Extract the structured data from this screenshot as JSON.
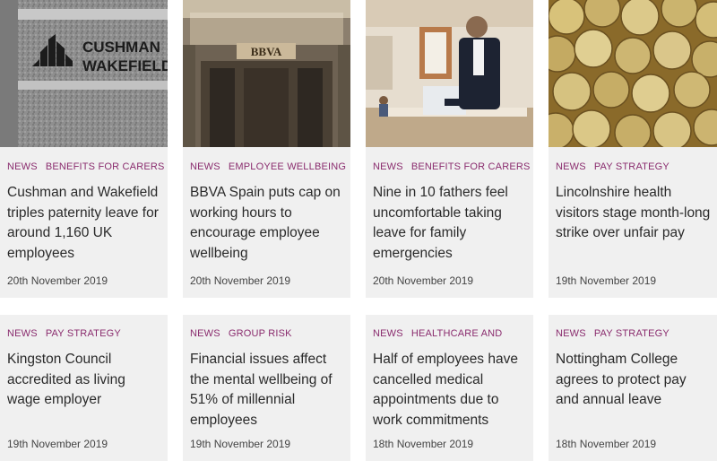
{
  "cards": [
    {
      "tags": [
        "NEWS",
        "BENEFITS FOR CARERS"
      ],
      "headline": "Cushman and Wakefield triples paternity leave for around 1,160 UK employees",
      "date": "20th November 2019",
      "image_logo": {
        "line1": "CUSHMAN",
        "line2": "WAKEFIELD"
      }
    },
    {
      "tags": [
        "NEWS",
        "EMPLOYEE WELLBEING"
      ],
      "headline": "BBVA Spain puts cap on working hours to encourage employee wellbeing",
      "date": "20th November 2019",
      "image_sign": "BBVA"
    },
    {
      "tags": [
        "NEWS",
        "BENEFITS FOR CARERS"
      ],
      "headline": "Nine in 10 fathers feel uncomfortable taking leave for family emergencies",
      "date": "20th November 2019"
    },
    {
      "tags": [
        "NEWS",
        "PAY STRATEGY"
      ],
      "headline": "Lincolnshire health visitors stage month-long strike over unfair pay",
      "date": "19th November 2019"
    },
    {
      "tags": [
        "NEWS",
        "PAY STRATEGY"
      ],
      "headline": "Kingston Council accredited as living wage employer",
      "date": "19th November 2019"
    },
    {
      "tags": [
        "NEWS",
        "GROUP RISK"
      ],
      "headline": "Financial issues affect the mental wellbeing of 51% of millennial employees",
      "date": "19th November 2019"
    },
    {
      "tags": [
        "NEWS",
        "HEALTHCARE AND"
      ],
      "headline": "Half of employees have cancelled medical appointments due to work commitments",
      "date": "18th November 2019"
    },
    {
      "tags": [
        "NEWS",
        "PAY STRATEGY"
      ],
      "headline": "Nottingham College agrees to protect pay and annual leave",
      "date": "18th November 2019"
    }
  ],
  "colors": {
    "tag": "#8a2c6e",
    "card_bg": "#f0f0f0",
    "headline": "#2a2a2a"
  }
}
